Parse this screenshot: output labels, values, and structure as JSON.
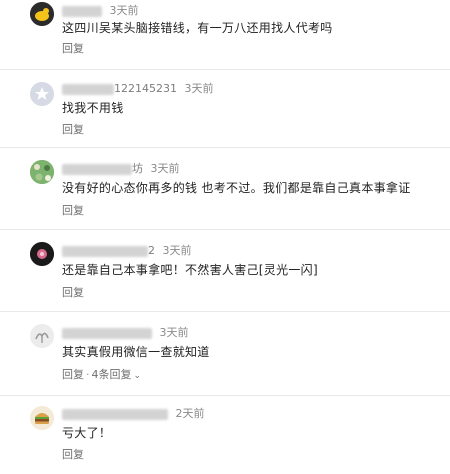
{
  "comments": [
    {
      "time": "3天前",
      "text": "这四川吴某头脑接错线，有一万八还用找人代考吗",
      "reply_label": "回复",
      "avatar": "yellow-bird-avatar"
    },
    {
      "username_tail": "122145231",
      "time": "3天前",
      "text": "找我不用钱",
      "reply_label": "回复",
      "avatar": "default-star-avatar"
    },
    {
      "username_tail": "坊",
      "time": "3天前",
      "text": "没有好的心态你再多的钱 也考不过。我们都是靠自己真本事拿证",
      "reply_label": "回复",
      "avatar": "green-pattern-avatar"
    },
    {
      "username_tail": "2",
      "time": "3天前",
      "text": "还是靠自己本事拿吧！不然害人害己[灵光一闪]",
      "reply_label": "回复",
      "avatar": "dark-flower-avatar"
    },
    {
      "time": "3天前",
      "text": "其实真假用微信一查就知道",
      "reply_label": "回复",
      "reply_count": "4条回复",
      "avatar": "gray-tree-avatar"
    },
    {
      "time": "2天前",
      "text": "亏大了！",
      "reply_label": "回复",
      "avatar": "burger-avatar"
    }
  ],
  "colors": {
    "text": "#222222",
    "meta": "#8a8a8a",
    "divider": "#e8e8e8"
  }
}
